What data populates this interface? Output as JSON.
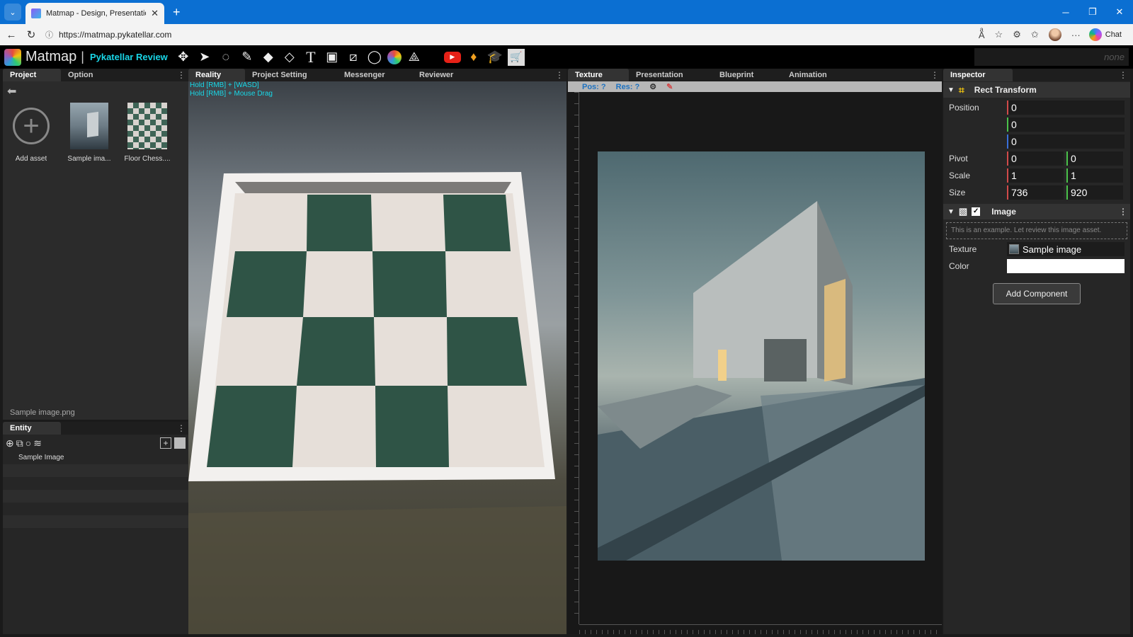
{
  "browser": {
    "tab_title": "Matmap - Design, Presentation, Si",
    "url": "https://matmap.pykatellar.com",
    "chat_label": "Chat"
  },
  "app": {
    "name": "Matmap",
    "separator": "|",
    "project": "Pykatellar Review",
    "search_placeholder": "none",
    "tools": [
      "move-icon",
      "pointer-icon",
      "lasso-icon",
      "pencil-icon",
      "paint-bucket-icon",
      "eraser-icon",
      "text-icon",
      "image-tool-icon",
      "line-icon",
      "circle-icon",
      "color-wheel-icon",
      "transform-icon"
    ],
    "extra_tools": [
      "youtube-icon",
      "gem-icon",
      "graduation-cap-icon",
      "cart-icon"
    ]
  },
  "project_panel": {
    "tabs": [
      "Project",
      "Option"
    ],
    "assets": [
      {
        "label": "Add asset"
      },
      {
        "label": "Sample ima..."
      },
      {
        "label": "Floor Chess...."
      }
    ],
    "selected_file": "Sample image.png"
  },
  "entity_panel": {
    "tab": "Entity",
    "rows": [
      "Sample Image",
      "",
      "",
      "",
      "",
      ""
    ]
  },
  "viewport_panel": {
    "tabs": [
      "Reality",
      "Project Setting",
      "Messenger",
      "Reviewer"
    ],
    "hints": [
      "Hold [RMB] + [WASD]",
      "Hold [RMB] + Mouse Drag"
    ]
  },
  "texture_panel": {
    "tabs": [
      "Texture",
      "Presentation",
      "Blueprint",
      "Animation"
    ],
    "pos_label": "Pos: ?",
    "res_label": "Res: ?"
  },
  "inspector": {
    "tab": "Inspector",
    "rect_transform": {
      "title": "Rect Transform",
      "position_label": "Position",
      "position": [
        "0",
        "0",
        "0"
      ],
      "pivot_label": "Pivot",
      "pivot": [
        "0",
        "0"
      ],
      "scale_label": "Scale",
      "scale": [
        "1",
        "1"
      ],
      "size_label": "Size",
      "size": [
        "736",
        "920"
      ]
    },
    "image": {
      "title": "Image",
      "note": "This is an example. Let review this image asset.",
      "texture_label": "Texture",
      "texture_value": "Sample image",
      "color_label": "Color",
      "color_value": "#ffffff"
    },
    "add_component": "Add Component"
  },
  "colors": {
    "accent_cyan": "#19d5e6",
    "browser_blue": "#0b6fd2"
  }
}
